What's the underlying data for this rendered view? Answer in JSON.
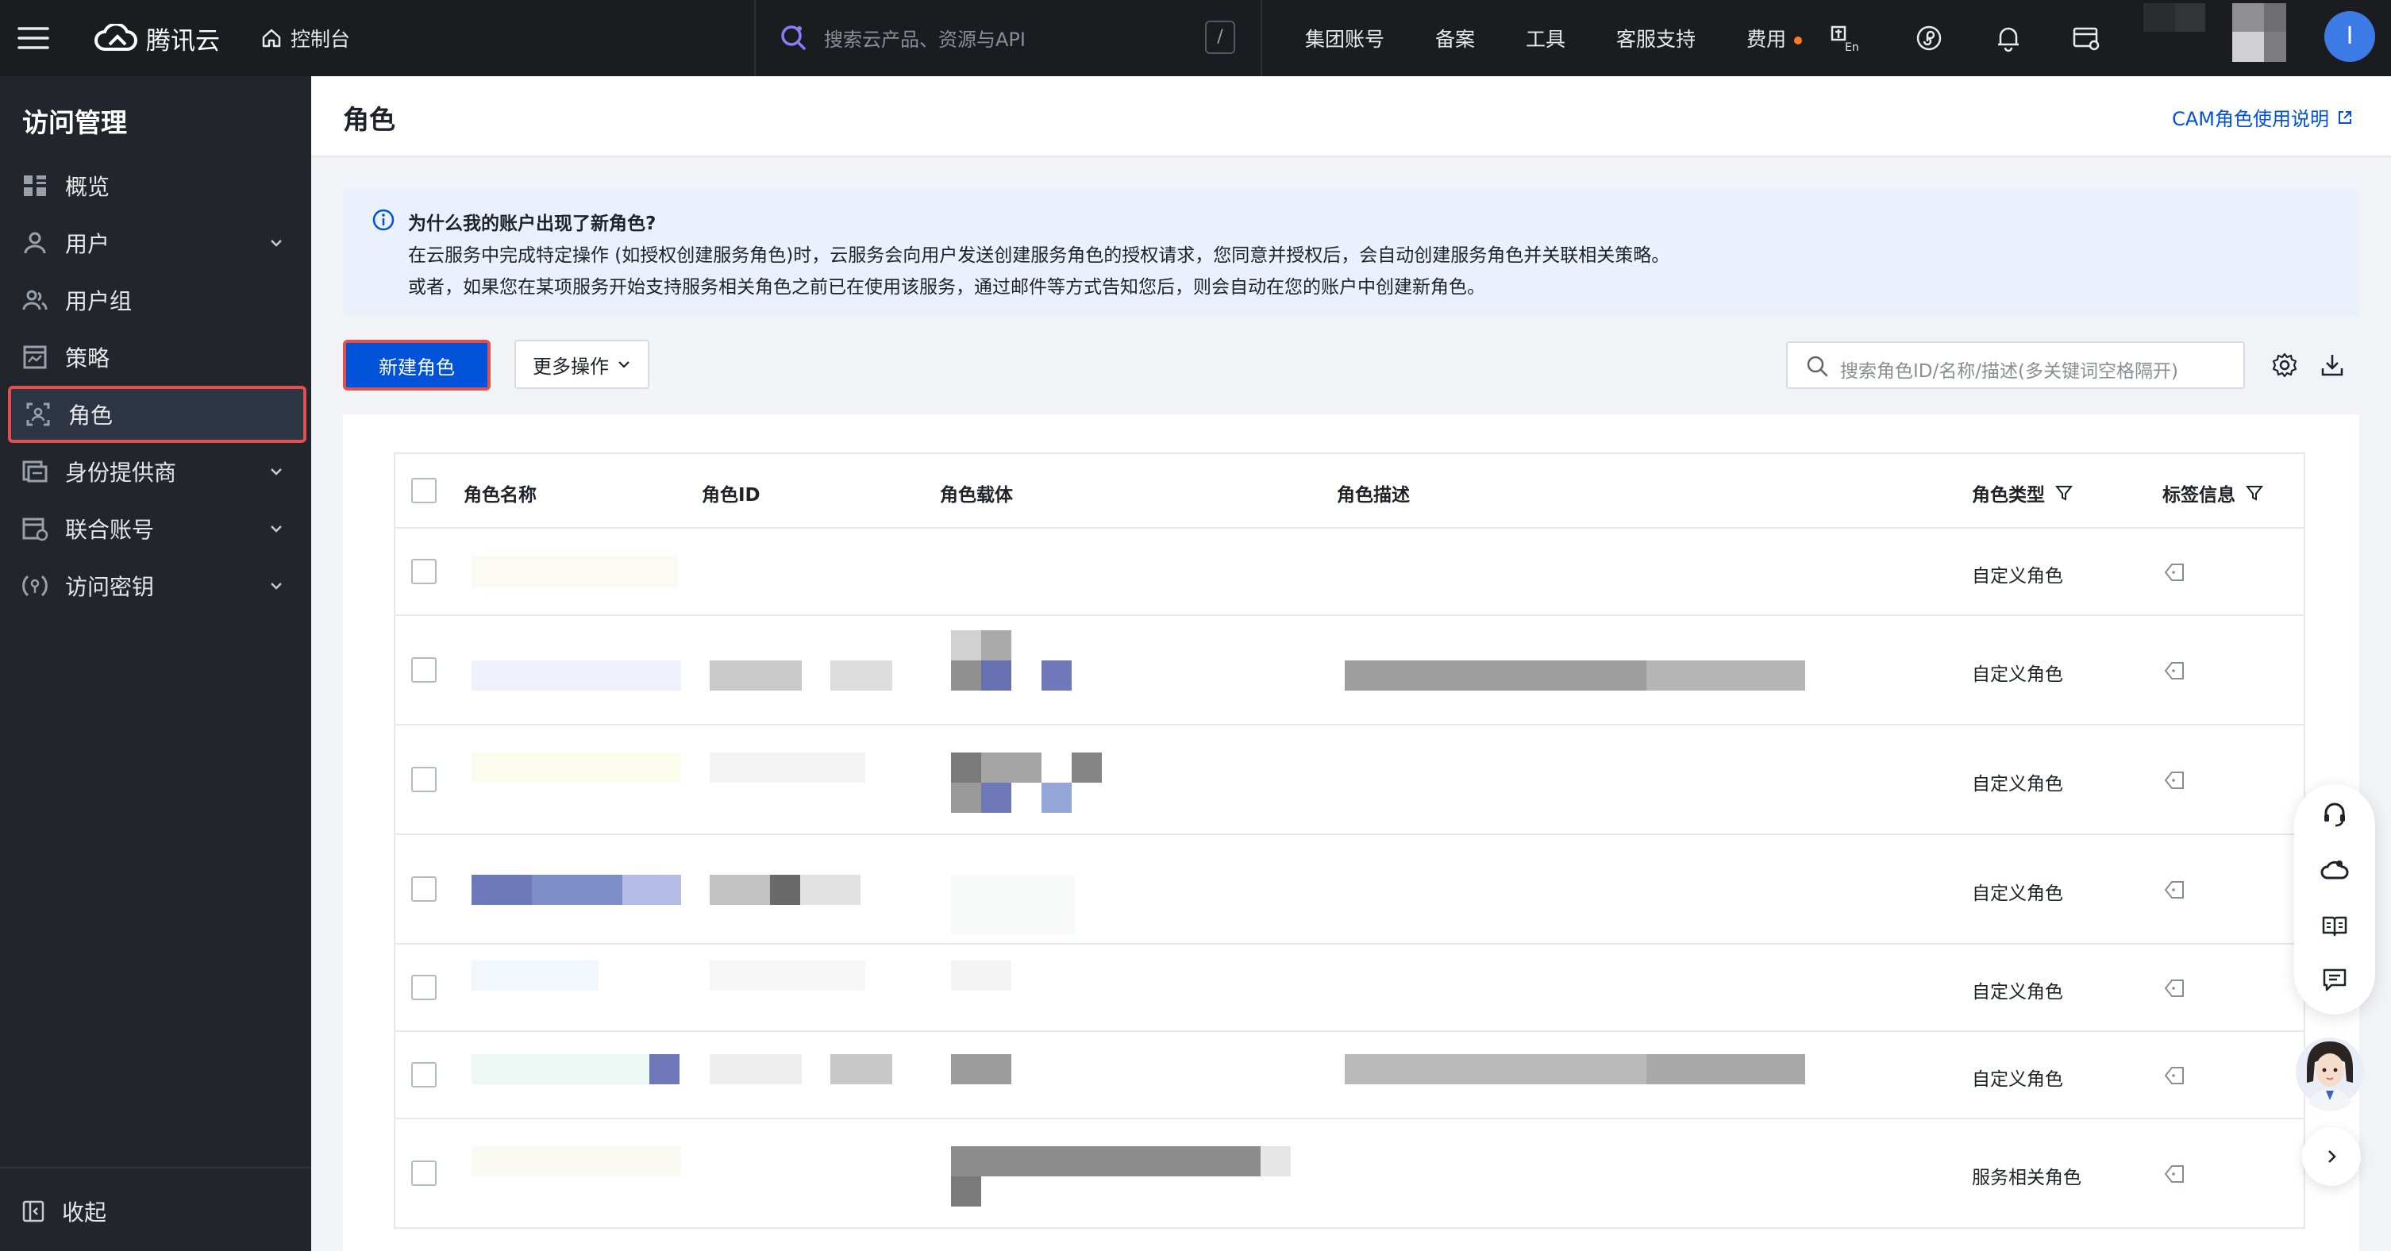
{
  "topbar": {
    "brand": "腾讯云",
    "console": "控制台",
    "search_placeholder": "搜索云产品、资源与API",
    "search_shortcut": "/",
    "nav": [
      "集团账号",
      "备案",
      "工具",
      "客服支持",
      "费用"
    ],
    "avatar_letter": "I"
  },
  "sidebar": {
    "title": "访问管理",
    "items": [
      {
        "label": "概览",
        "icon": "overview-icon",
        "expandable": false
      },
      {
        "label": "用户",
        "icon": "user-icon",
        "expandable": true
      },
      {
        "label": "用户组",
        "icon": "user-group-icon",
        "expandable": false
      },
      {
        "label": "策略",
        "icon": "policy-icon",
        "expandable": false
      },
      {
        "label": "角色",
        "icon": "role-icon",
        "expandable": false,
        "active": true
      },
      {
        "label": "身份提供商",
        "icon": "identity-provider-icon",
        "expandable": true
      },
      {
        "label": "联合账号",
        "icon": "federated-account-icon",
        "expandable": true
      },
      {
        "label": "访问密钥",
        "icon": "access-key-icon",
        "expandable": true
      }
    ],
    "collapse": "收起"
  },
  "header": {
    "title": "角色",
    "doc_link": "CAM角色使用说明"
  },
  "notice": {
    "title": "为什么我的账户出现了新角色?",
    "line1": "在云服务中完成特定操作 (如授权创建服务角色)时，云服务会向用户发送创建服务角色的授权请求，您同意并授权后，会自动创建服务角色并关联相关策略。",
    "line2": "或者，如果您在某项服务开始支持服务相关角色之前已在使用该服务，通过邮件等方式告知您后，则会自动在您的账户中创建新角色。"
  },
  "toolbar": {
    "create": "新建角色",
    "more": "更多操作",
    "search_placeholder": "搜索角色ID/名称/描述(多关键词空格隔开)"
  },
  "table": {
    "columns": [
      "角色名称",
      "角色ID",
      "角色载体",
      "角色描述",
      "角色类型",
      "标签信息"
    ],
    "rows": [
      {
        "type": "自定义角色"
      },
      {
        "type": "自定义角色"
      },
      {
        "type": "自定义角色"
      },
      {
        "type": "自定义角色"
      },
      {
        "type": "自定义角色"
      },
      {
        "type": "自定义角色"
      },
      {
        "type": "服务相关角色"
      }
    ]
  },
  "colors": {
    "topbar_bg": "#1b1c1f",
    "sidebar_bg": "#22252b",
    "primary": "#0052d9",
    "highlight_border": "#e0504f",
    "notice_bg": "#eaf0fc"
  }
}
